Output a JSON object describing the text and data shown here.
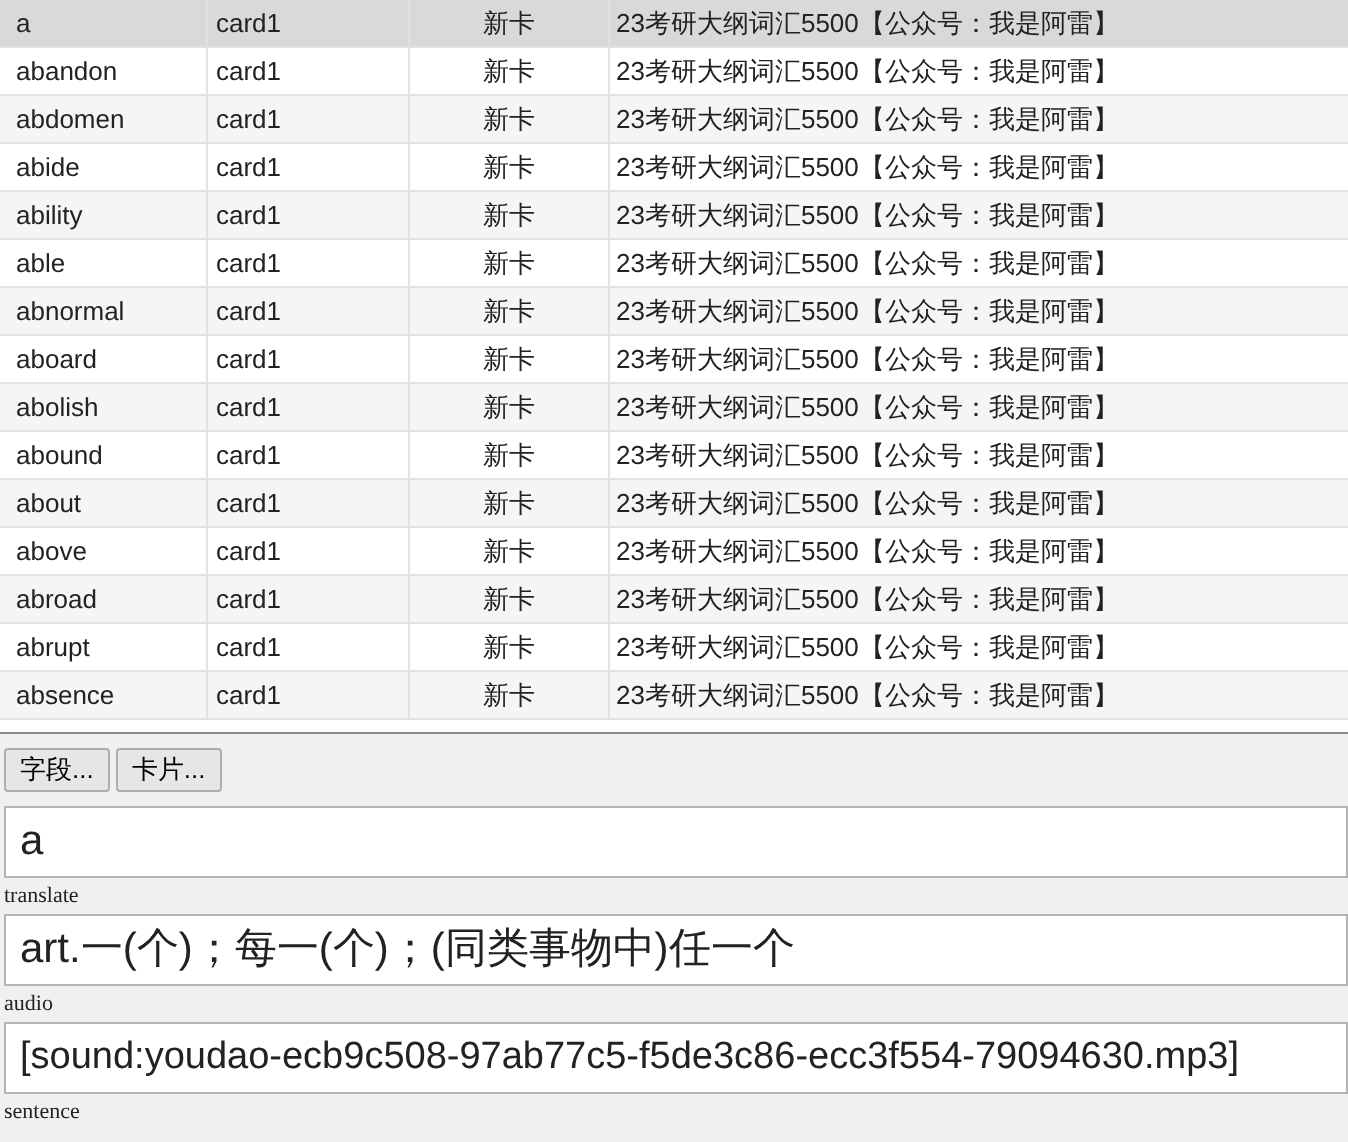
{
  "table": {
    "rows": [
      {
        "word": "a",
        "card": "card1",
        "state": "新卡",
        "deck": "23考研大纲词汇5500【公众号：我是阿雷】",
        "selected": true
      },
      {
        "word": "abandon",
        "card": "card1",
        "state": "新卡",
        "deck": "23考研大纲词汇5500【公众号：我是阿雷】",
        "selected": false
      },
      {
        "word": "abdomen",
        "card": "card1",
        "state": "新卡",
        "deck": "23考研大纲词汇5500【公众号：我是阿雷】",
        "selected": false
      },
      {
        "word": "abide",
        "card": "card1",
        "state": "新卡",
        "deck": "23考研大纲词汇5500【公众号：我是阿雷】",
        "selected": false
      },
      {
        "word": "ability",
        "card": "card1",
        "state": "新卡",
        "deck": "23考研大纲词汇5500【公众号：我是阿雷】",
        "selected": false
      },
      {
        "word": "able",
        "card": "card1",
        "state": "新卡",
        "deck": "23考研大纲词汇5500【公众号：我是阿雷】",
        "selected": false
      },
      {
        "word": "abnormal",
        "card": "card1",
        "state": "新卡",
        "deck": "23考研大纲词汇5500【公众号：我是阿雷】",
        "selected": false
      },
      {
        "word": "aboard",
        "card": "card1",
        "state": "新卡",
        "deck": "23考研大纲词汇5500【公众号：我是阿雷】",
        "selected": false
      },
      {
        "word": "abolish",
        "card": "card1",
        "state": "新卡",
        "deck": "23考研大纲词汇5500【公众号：我是阿雷】",
        "selected": false
      },
      {
        "word": "abound",
        "card": "card1",
        "state": "新卡",
        "deck": "23考研大纲词汇5500【公众号：我是阿雷】",
        "selected": false
      },
      {
        "word": "about",
        "card": "card1",
        "state": "新卡",
        "deck": "23考研大纲词汇5500【公众号：我是阿雷】",
        "selected": false
      },
      {
        "word": "above",
        "card": "card1",
        "state": "新卡",
        "deck": "23考研大纲词汇5500【公众号：我是阿雷】",
        "selected": false
      },
      {
        "word": "abroad",
        "card": "card1",
        "state": "新卡",
        "deck": "23考研大纲词汇5500【公众号：我是阿雷】",
        "selected": false
      },
      {
        "word": "abrupt",
        "card": "card1",
        "state": "新卡",
        "deck": "23考研大纲词汇5500【公众号：我是阿雷】",
        "selected": false
      },
      {
        "word": "absence",
        "card": "card1",
        "state": "新卡",
        "deck": "23考研大纲词汇5500【公众号：我是阿雷】",
        "selected": false
      }
    ]
  },
  "buttons": [
    "字段...",
    "卡片..."
  ],
  "fields": [
    {
      "value": "a"
    },
    {
      "label": "translate",
      "value": "art.一(个)；每一(个)；(同类事物中)任一个"
    },
    {
      "label": "audio",
      "value": "[sound:youdao-ecb9c508-97ab77c5-f5de3c86-ecc3f554-79094630.mp3]"
    },
    {
      "label": "sentence"
    }
  ]
}
